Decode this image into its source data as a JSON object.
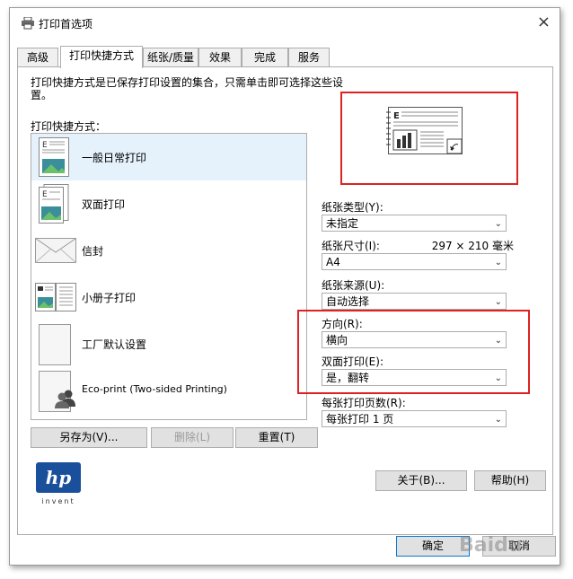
{
  "window": {
    "title": "打印首选项",
    "close": "×"
  },
  "tabs": [
    {
      "label": "高级"
    },
    {
      "label": "打印快捷方式"
    },
    {
      "label": "纸张/质量"
    },
    {
      "label": "效果"
    },
    {
      "label": "完成"
    },
    {
      "label": "服务"
    }
  ],
  "shortcuts": {
    "description": "打印快捷方式是已保存打印设置的集合，只需单击即可选择这些设置。",
    "label": "打印快捷方式：",
    "items": [
      {
        "label": "一般日常打印"
      },
      {
        "label": "双面打印"
      },
      {
        "label": "信封"
      },
      {
        "label": "小册子打印"
      },
      {
        "label": "工厂默认设置"
      },
      {
        "label": "Eco-print (Two-sided Printing)"
      }
    ],
    "buttons": {
      "save_as": "另存为(V)...",
      "delete": "删除(L)",
      "reset": "重置(T)"
    }
  },
  "settings": {
    "paper_type": {
      "label": "纸张类型(Y):",
      "value": "未指定"
    },
    "paper_size": {
      "label": "纸张尺寸(I):",
      "dimensions": "297 × 210 毫米",
      "value": "A4"
    },
    "paper_source": {
      "label": "纸张来源(U):",
      "value": "自动选择"
    },
    "orientation": {
      "label": "方向(R):",
      "value": "横向"
    },
    "duplex": {
      "label": "双面打印(E):",
      "value": "是，翻转"
    },
    "pages_per_sheet": {
      "label": "每张打印页数(R):",
      "value": "每张打印 1 页"
    }
  },
  "buttons": {
    "about": "关于(B)...",
    "help": "帮助(H)",
    "ok": "确定",
    "cancel": "取消"
  },
  "logo": {
    "brand": "hp",
    "tagline": "invent"
  },
  "watermark": {
    "text": "Baidu"
  },
  "colors": {
    "annotation_red": "#d22222",
    "selected_row": "#e5f1fb",
    "hp_blue": "#1a4f9c"
  }
}
